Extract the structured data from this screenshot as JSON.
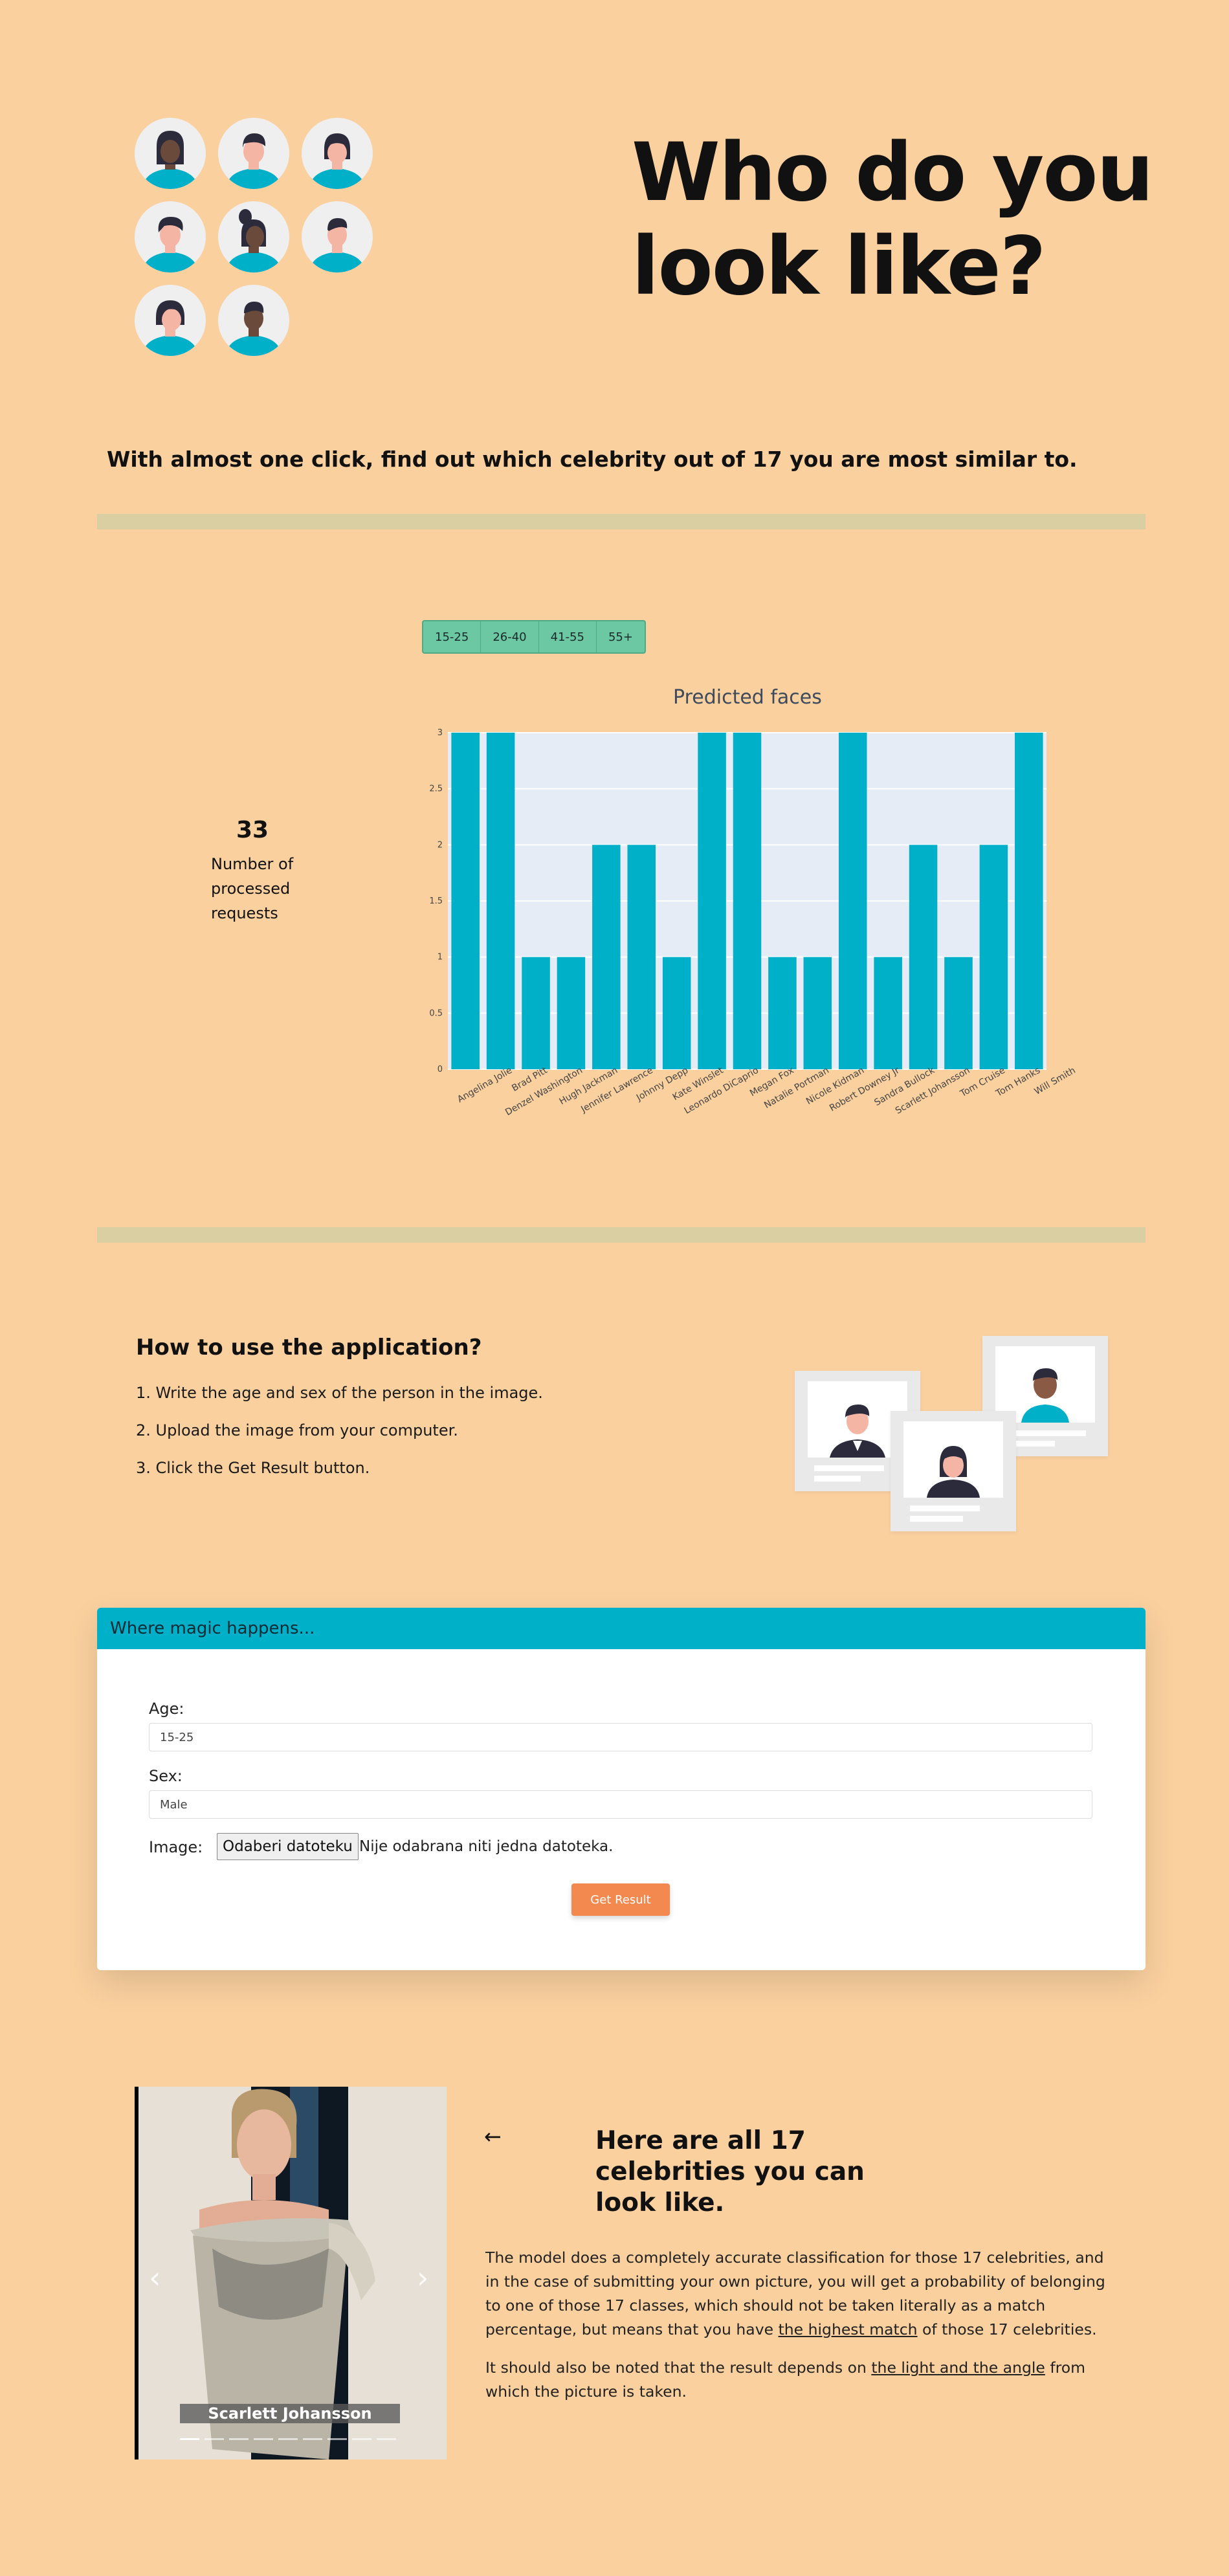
{
  "hero": {
    "title": "Who do you look like?",
    "tagline": "With almost one click, find out which celebrity out of 17 you are most similar to."
  },
  "stats": {
    "age_filters": [
      "15-25",
      "26-40",
      "41-55",
      "55+"
    ],
    "request_count": "33",
    "request_label": "Number of processed requests"
  },
  "chart_data": {
    "type": "bar",
    "title": "Predicted faces",
    "categories": [
      "Angelina Jolie",
      "Brad Pitt",
      "Denzel Washington",
      "Hugh Jackman",
      "Jennifer Lawrence",
      "Johnny Depp",
      "Kate Winslet",
      "Leonardo DiCaprio",
      "Megan Fox",
      "Natalie Portman",
      "Nicole Kidman",
      "Robert Downey Jr",
      "Sandra Bullock",
      "Scarlett Johansson",
      "Tom Cruise",
      "Tom Hanks",
      "Will Smith"
    ],
    "values": [
      3,
      3,
      1,
      1,
      2,
      2,
      1,
      3,
      3,
      1,
      1,
      3,
      1,
      2,
      1,
      2,
      3
    ],
    "ylim": [
      0,
      3
    ],
    "yticks": [
      "0",
      "0.5",
      "1",
      "1.5",
      "2",
      "2.5",
      "3"
    ],
    "grid": true,
    "bar_color": "#00AFC8",
    "plot_bg": "#E5ECF6"
  },
  "howto": {
    "title": "How to use the application?",
    "steps": [
      "1. Write the age and sex of the person in the image.",
      "2. Upload the image from your computer.",
      "3. Click the Get Result button."
    ]
  },
  "form": {
    "header": "Where magic happens...",
    "age_label": "Age:",
    "age_value": "15-25",
    "sex_label": "Sex:",
    "sex_value": "Male",
    "image_label": "Image:",
    "file_button": "Odaberi datoteku",
    "file_status": "Nije odabrana niti jedna datoteka.",
    "submit": "Get Result"
  },
  "celebs": {
    "caption": "Scarlett Johansson",
    "back_icon": "arrow-left-icon",
    "heading": "Here are all 17 celebrities you can look like.",
    "p1_a": "The model does a completely accurate classification for those 17 celebrities, and in the case of submitting your own picture, you will get a probability of belonging to one of those 17 classes, which should not be taken literally as a match percentage, but means that you have ",
    "p1_u": "the highest match",
    "p1_b": " of those 17 celebrities.",
    "p2_a": "It should also be noted that the result depends on ",
    "p2_u": "the light and the angle",
    "p2_b": " from which the picture is taken."
  },
  "colors": {
    "page_bg": "#FAD09F",
    "accent_teal": "#00AFC8",
    "button_orange": "#F4894F",
    "filter_green": "#6CC7A3",
    "divider": "#D9CFA2"
  }
}
